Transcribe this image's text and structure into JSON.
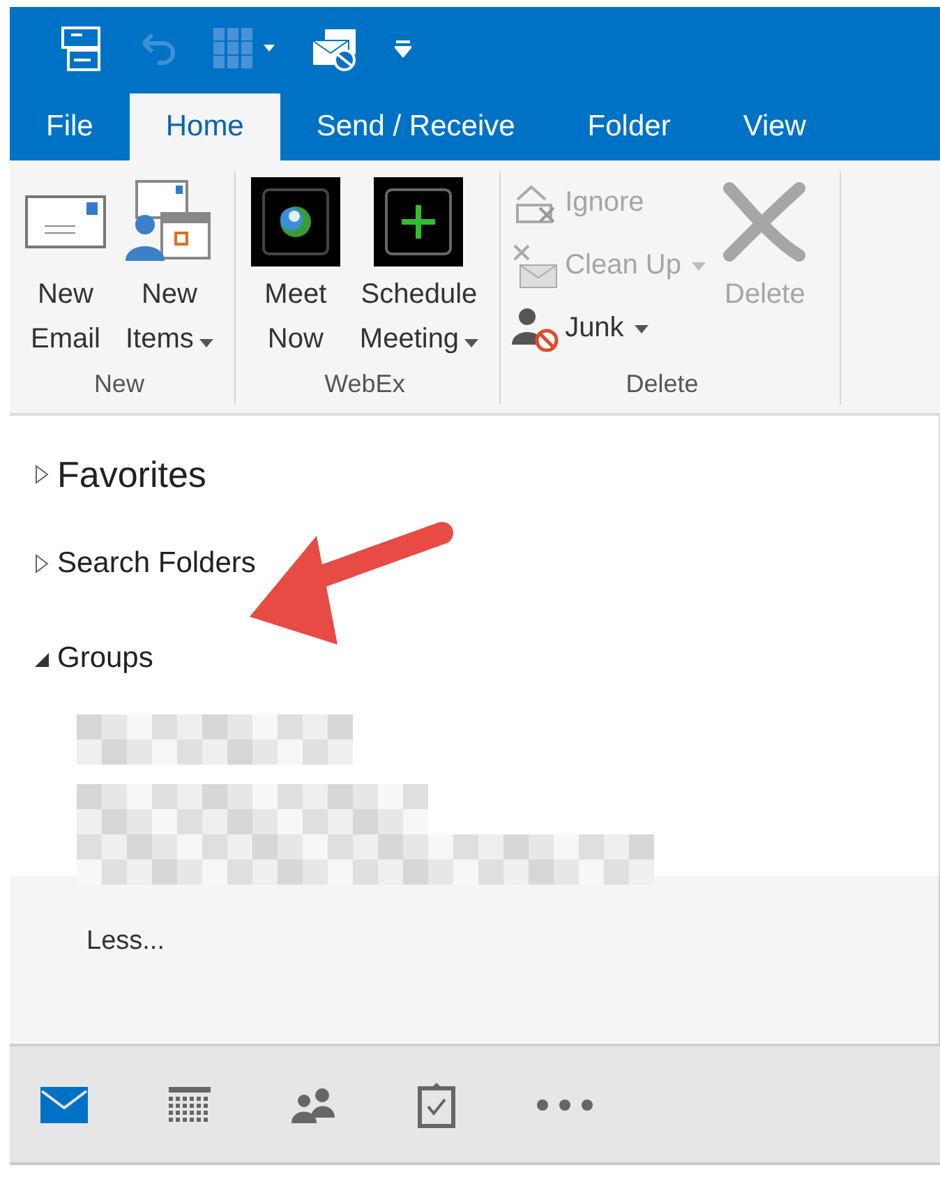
{
  "tabs": [
    {
      "label": "File",
      "selected": false
    },
    {
      "label": "Home",
      "selected": true
    },
    {
      "label": "Send / Receive",
      "selected": false
    },
    {
      "label": "Folder",
      "selected": false
    },
    {
      "label": "View",
      "selected": false
    }
  ],
  "ribbon_groups": [
    {
      "label": "New",
      "buttons": [
        {
          "kind": "large",
          "lines": [
            "New",
            "Email"
          ],
          "dropdown": false,
          "disabled": false
        },
        {
          "kind": "large",
          "lines": [
            "New",
            "Items"
          ],
          "dropdown": true,
          "disabled": false
        }
      ]
    },
    {
      "label": "WebEx",
      "buttons": [
        {
          "kind": "large",
          "lines": [
            "Meet",
            "Now"
          ],
          "dropdown": false,
          "disabled": false
        },
        {
          "kind": "large",
          "lines": [
            "Schedule",
            "Meeting"
          ],
          "dropdown": true,
          "disabled": false
        }
      ]
    },
    {
      "label": "Delete",
      "buttons": [
        {
          "kind": "small",
          "lines": [
            "Ignore"
          ],
          "dropdown": false,
          "disabled": true
        },
        {
          "kind": "small",
          "lines": [
            "Clean Up"
          ],
          "dropdown": true,
          "disabled": true
        },
        {
          "kind": "small",
          "lines": [
            "Junk"
          ],
          "dropdown": true,
          "disabled": false
        },
        {
          "kind": "large",
          "lines": [
            "Delete"
          ],
          "dropdown": false,
          "disabled": true
        }
      ]
    }
  ],
  "folders": [
    {
      "kind": "favorites",
      "label": "Favorites",
      "expanded": false
    },
    {
      "kind": "folder",
      "label": "Search Folders",
      "expanded": false
    },
    {
      "kind": "folder",
      "label": "Groups",
      "expanded": true,
      "children": [
        {
          "kind": "redacted"
        },
        {
          "kind": "redacted"
        }
      ]
    }
  ],
  "less_link": "Less...",
  "nav_items": [
    {
      "selected": true
    },
    {
      "selected": false
    },
    {
      "selected": false
    },
    {
      "selected": false
    },
    {
      "selected": false
    }
  ]
}
